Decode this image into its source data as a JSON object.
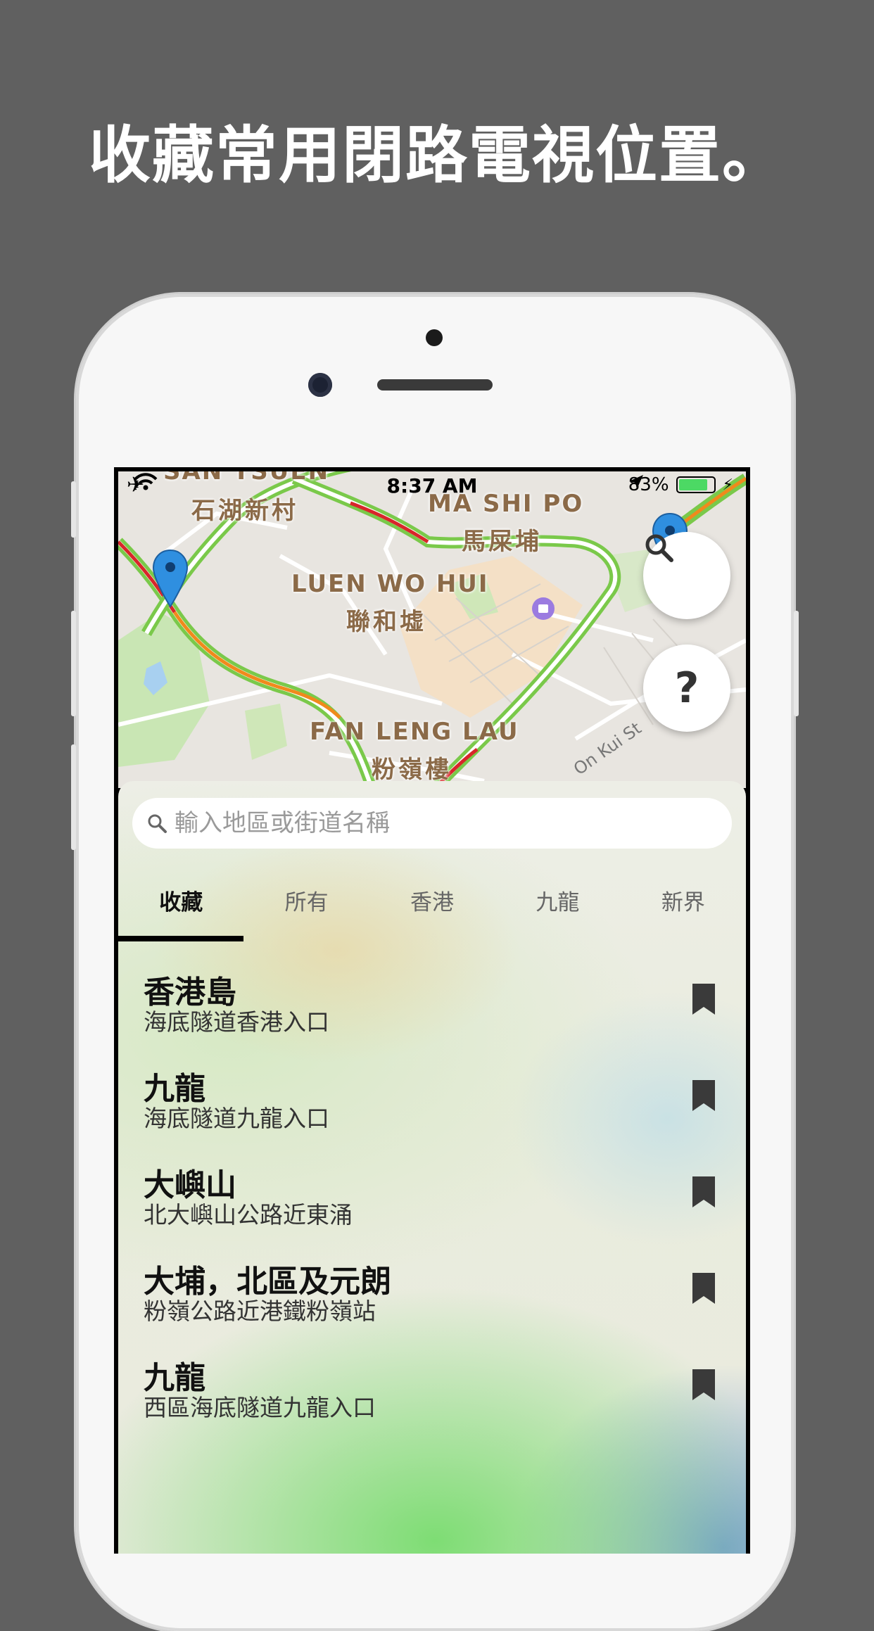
{
  "headline": "收藏常用閉路電視位置。",
  "status_bar": {
    "time": "8:37 AM",
    "battery": "83%",
    "battery_level": 0.83
  },
  "map": {
    "labels": [
      {
        "text": "SAN TSUEN",
        "kind": "en"
      },
      {
        "text": "石湖新村",
        "kind": "cn"
      },
      {
        "text": "MA SHI PO",
        "kind": "en"
      },
      {
        "text": "馬屎埔",
        "kind": "cn"
      },
      {
        "text": "LUEN WO HUI",
        "kind": "en"
      },
      {
        "text": "聯和墟",
        "kind": "cn"
      },
      {
        "text": "FAN LENG LAU",
        "kind": "en"
      },
      {
        "text": "粉嶺樓",
        "kind": "cn"
      }
    ],
    "street": "On Kui St",
    "search_button_icon": "search-icon",
    "help_button_label": "?"
  },
  "search": {
    "placeholder": "輸入地區或街道名稱",
    "value": ""
  },
  "tabs": [
    {
      "label": "收藏",
      "active": true
    },
    {
      "label": "所有",
      "active": false
    },
    {
      "label": "香港",
      "active": false
    },
    {
      "label": "九龍",
      "active": false
    },
    {
      "label": "新界",
      "active": false
    }
  ],
  "favorites": [
    {
      "title": "香港島",
      "subtitle": "海底隧道香港入口",
      "icon": "bookmark-icon"
    },
    {
      "title": "九龍",
      "subtitle": "海底隧道九龍入口",
      "icon": "bookmark-icon"
    },
    {
      "title": "大嶼山",
      "subtitle": "北大嶼山公路近東涌",
      "icon": "bookmark-icon"
    },
    {
      "title": "大埔，北區及元朗",
      "subtitle": "粉嶺公路近港鐵粉嶺站",
      "icon": "bookmark-icon"
    },
    {
      "title": "九龍",
      "subtitle": "西區海底隧道九龍入口",
      "icon": "bookmark-icon"
    }
  ],
  "colors": {
    "background": "#606060",
    "tab_indicator": "#000000",
    "pin": "#2f8fe0",
    "traffic_green": "#7ac94a",
    "traffic_red": "#d8262a",
    "traffic_orange": "#f08a1c",
    "battery_fill": "#4cd964"
  }
}
